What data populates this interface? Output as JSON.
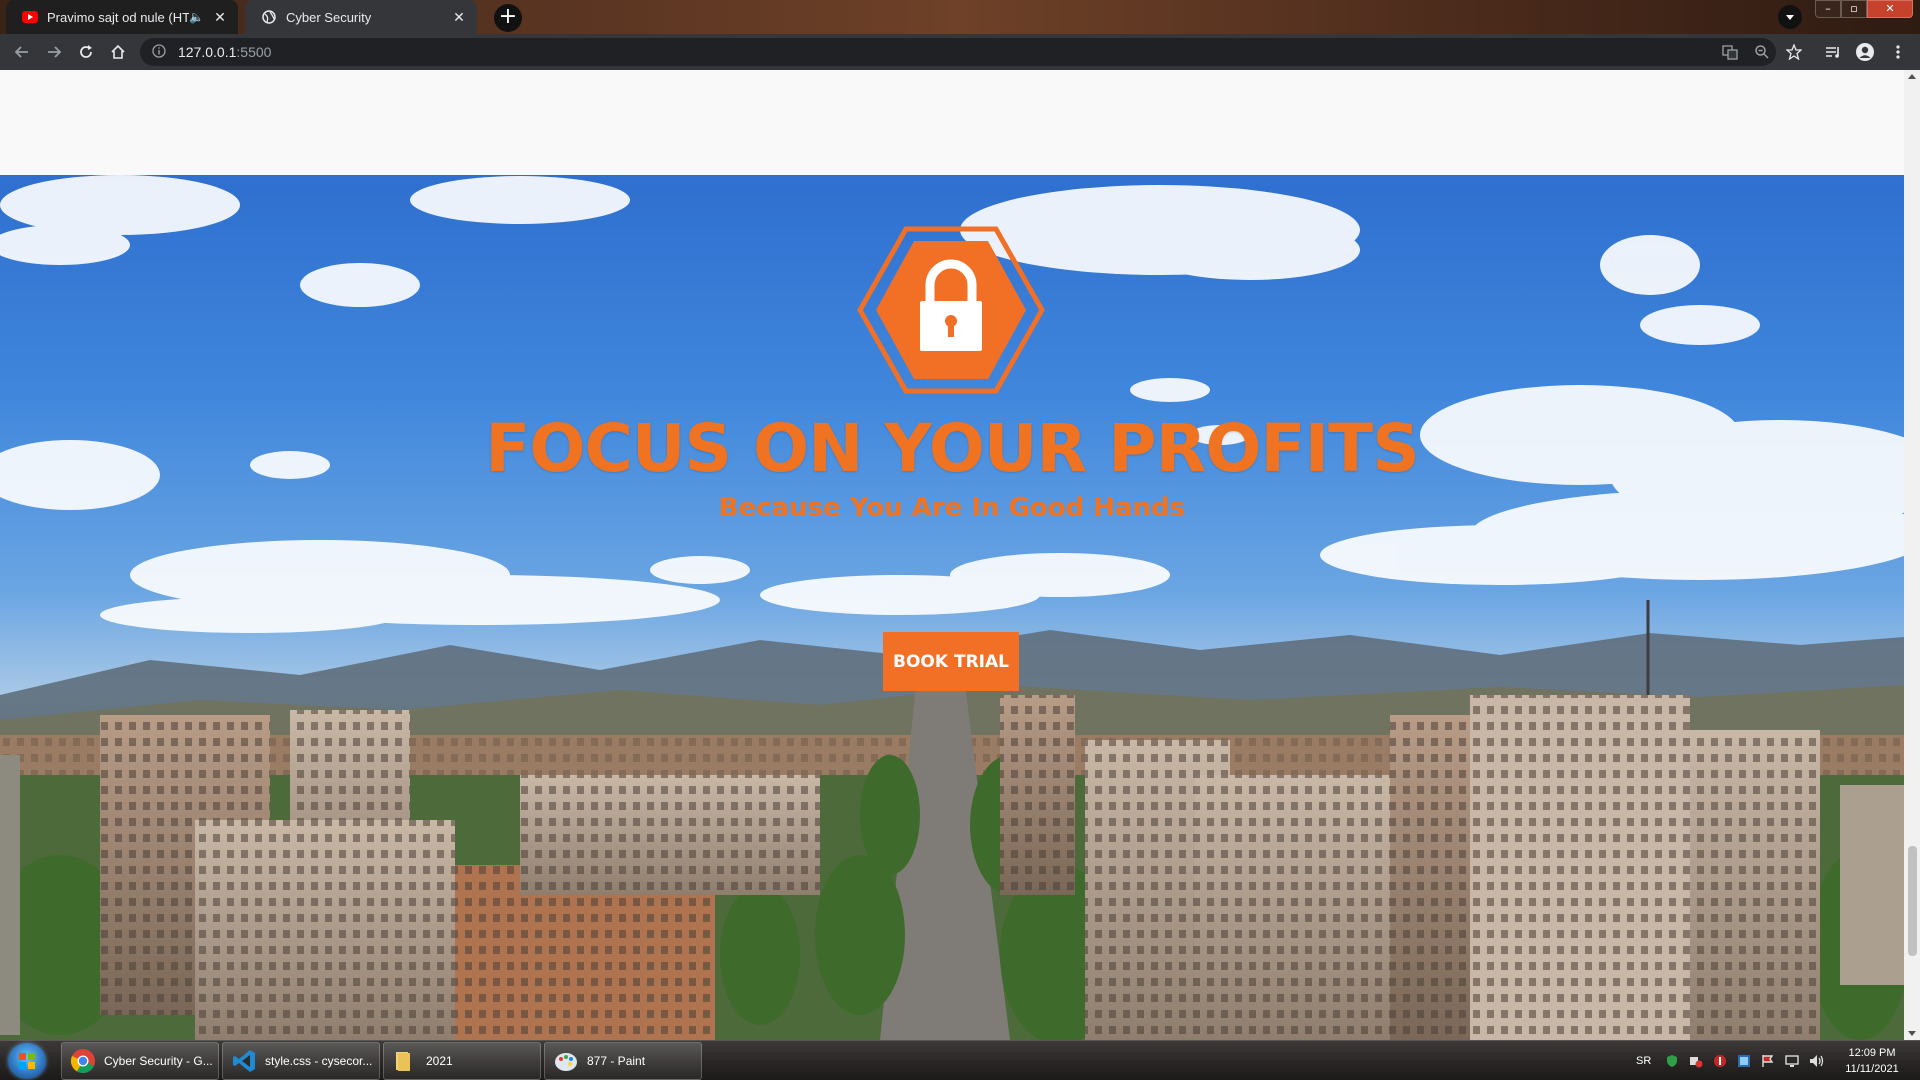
{
  "browser": {
    "tabs": [
      {
        "title": "Pravimo sajt od nule (HTML i",
        "favicon": "youtube-icon"
      },
      {
        "title": "Cyber Security",
        "favicon": "globe-icon"
      }
    ],
    "url_host": "127.0.0.1",
    "url_port": ":5500",
    "new_tab_symbol": "+"
  },
  "page": {
    "hero_title": "FOCUS ON YOUR PROFITS",
    "hero_subtitle": "Because You Are In Good Hands",
    "cta_label": "BOOK TRIAL",
    "accent_color": "#f27026",
    "logo_icon": "padlock-hexagon-icon"
  },
  "taskbar": {
    "buttons": [
      {
        "label": "Cyber Security - G...",
        "icon": "chrome-icon"
      },
      {
        "label": "style.css - cysecor...",
        "icon": "vscode-icon"
      },
      {
        "label": "2021",
        "icon": "folder-icon"
      },
      {
        "label": "877 - Paint",
        "icon": "paint-icon"
      }
    ],
    "language": "SR",
    "time": "12:09 PM",
    "date": "11/11/2021"
  },
  "scroll_position_fraction": 0.8
}
